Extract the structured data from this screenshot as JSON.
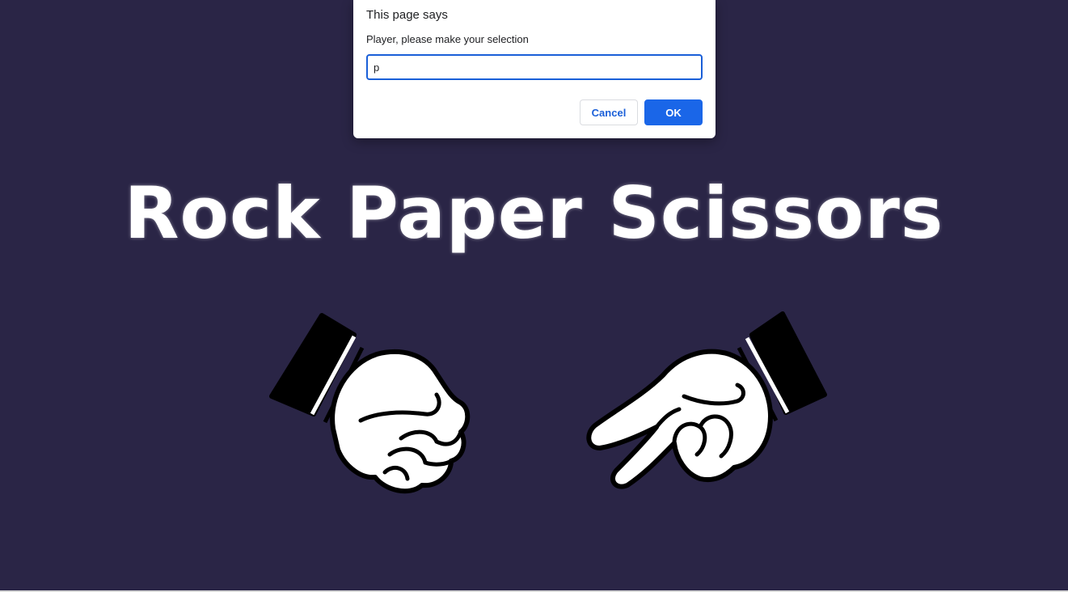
{
  "game": {
    "title": "Rock Paper Scissors"
  },
  "hands": {
    "left": {
      "icon": "rock-fist-icon"
    },
    "right": {
      "icon": "scissors-hand-icon"
    }
  },
  "dialog": {
    "title": "This page says",
    "message": "Player, please make your selection",
    "input_value": "p",
    "cancel_label": "Cancel",
    "ok_label": "OK"
  },
  "colors": {
    "background": "#2a2546",
    "accent": "#1a66e8",
    "title_text": "#ffffff"
  }
}
